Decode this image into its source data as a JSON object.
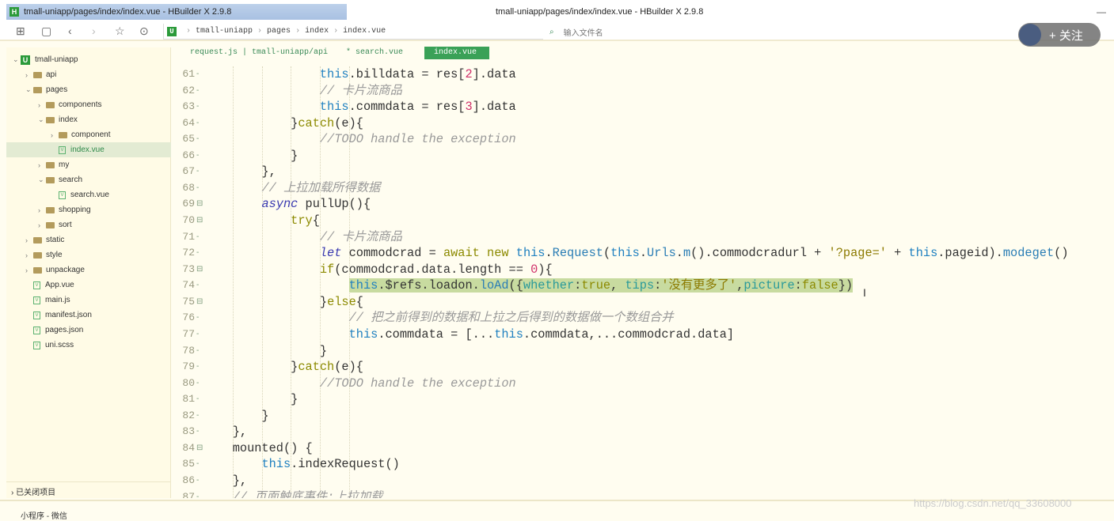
{
  "window": {
    "title": "tmall-uniapp/pages/index/index.vue - HBuilder X 2.9.8",
    "center_title": "tmall-uniapp/pages/index/index.vue - HBuilder X 2.9.8",
    "minimize": "—"
  },
  "toolbar": {
    "breadcrumb": [
      "tmall-uniapp",
      "pages",
      "index",
      "index.vue"
    ],
    "search_placeholder": "输入文件名"
  },
  "follow": {
    "label": "+ 关注"
  },
  "tabs": [
    {
      "label": "request.js | tmall-uniapp/api"
    },
    {
      "label": "* search.vue"
    },
    {
      "label": "index.vue",
      "active": true
    }
  ],
  "sidebar": {
    "items": [
      {
        "label": "tmall-uniapp",
        "type": "project",
        "level": 0,
        "open": true
      },
      {
        "label": "api",
        "type": "folder",
        "level": 1
      },
      {
        "label": "pages",
        "type": "folder",
        "level": 1,
        "open": true
      },
      {
        "label": "components",
        "type": "folder",
        "level": 2
      },
      {
        "label": "index",
        "type": "folder",
        "level": 2,
        "open": true
      },
      {
        "label": "component",
        "type": "folder",
        "level": 3
      },
      {
        "label": "index.vue",
        "type": "file",
        "level": 3,
        "selected": true
      },
      {
        "label": "my",
        "type": "folder",
        "level": 2
      },
      {
        "label": "search",
        "type": "folder",
        "level": 2,
        "open": true
      },
      {
        "label": "search.vue",
        "type": "file",
        "level": 3
      },
      {
        "label": "shopping",
        "type": "folder",
        "level": 2
      },
      {
        "label": "sort",
        "type": "folder",
        "level": 2
      },
      {
        "label": "static",
        "type": "folder",
        "level": 1
      },
      {
        "label": "style",
        "type": "folder",
        "level": 1
      },
      {
        "label": "unpackage",
        "type": "folder",
        "level": 1
      },
      {
        "label": "App.vue",
        "type": "file",
        "level": 1
      },
      {
        "label": "main.js",
        "type": "file",
        "level": 1
      },
      {
        "label": "manifest.json",
        "type": "file",
        "level": 1
      },
      {
        "label": "pages.json",
        "type": "file",
        "level": 1
      },
      {
        "label": "uni.scss",
        "type": "file",
        "level": 1
      }
    ],
    "closed_projects": "已关闭项目"
  },
  "editor": {
    "lines": [
      {
        "n": "61",
        "t": [
          [
            "",
            "                "
          ],
          [
            "kw",
            "this"
          ],
          [
            "",
            ".billdata = res["
          ],
          [
            "num",
            "2"
          ],
          [
            "",
            "].data"
          ]
        ]
      },
      {
        "n": "62",
        "t": [
          [
            "",
            "                "
          ],
          [
            "cm",
            "// 卡片流商品"
          ]
        ]
      },
      {
        "n": "63",
        "t": [
          [
            "",
            "                "
          ],
          [
            "kw",
            "this"
          ],
          [
            "",
            ".commdata = res["
          ],
          [
            "num",
            "3"
          ],
          [
            "",
            "].data"
          ]
        ]
      },
      {
        "n": "64",
        "t": [
          [
            "",
            "            }"
          ],
          [
            "ctl",
            "catch"
          ],
          [
            "",
            "(e){"
          ]
        ]
      },
      {
        "n": "65",
        "t": [
          [
            "",
            "                "
          ],
          [
            "cm",
            "//TODO handle the exception"
          ]
        ]
      },
      {
        "n": "66",
        "t": [
          [
            "",
            "            }"
          ]
        ]
      },
      {
        "n": "67",
        "t": [
          [
            "",
            "        },"
          ]
        ]
      },
      {
        "n": "68",
        "t": [
          [
            "",
            "        "
          ],
          [
            "cm",
            "// 上拉加载所得数据"
          ]
        ]
      },
      {
        "n": "69",
        "fold": true,
        "t": [
          [
            "",
            "        "
          ],
          [
            "dec",
            "async"
          ],
          [
            "",
            " pullUp(){"
          ]
        ]
      },
      {
        "n": "70",
        "fold": true,
        "t": [
          [
            "",
            "            "
          ],
          [
            "ctl",
            "try"
          ],
          [
            "",
            "{"
          ]
        ]
      },
      {
        "n": "71",
        "t": [
          [
            "",
            "                "
          ],
          [
            "cm",
            "// 卡片流商品"
          ]
        ]
      },
      {
        "n": "72",
        "t": [
          [
            "",
            "                "
          ],
          [
            "dec",
            "let"
          ],
          [
            "",
            " commodcrad = "
          ],
          [
            "ctl",
            "await"
          ],
          [
            "",
            " "
          ],
          [
            "ctl",
            "new"
          ],
          [
            "",
            " "
          ],
          [
            "kw",
            "this"
          ],
          [
            "",
            "."
          ],
          [
            "fn",
            "Request"
          ],
          [
            "",
            "("
          ],
          [
            "kw",
            "this"
          ],
          [
            "",
            "."
          ],
          [
            "fn",
            "Urls"
          ],
          [
            "",
            "."
          ],
          [
            "fn",
            "m"
          ],
          [
            "",
            "().commodcradurl + "
          ],
          [
            "str",
            "'?page='"
          ],
          [
            "",
            " + "
          ],
          [
            "kw",
            "this"
          ],
          [
            "",
            ".pageid)."
          ],
          [
            "fn",
            "modeget"
          ],
          [
            "",
            "()"
          ]
        ]
      },
      {
        "n": "73",
        "fold": true,
        "t": [
          [
            "",
            "                "
          ],
          [
            "ctl",
            "if"
          ],
          [
            "",
            "(commodcrad.data.length == "
          ],
          [
            "num",
            "0"
          ],
          [
            "",
            "){"
          ]
        ]
      },
      {
        "n": "74",
        "hl": true,
        "t": [
          [
            "",
            "                    "
          ],
          [
            "kw",
            "this"
          ],
          [
            "",
            ".$refs.loadon."
          ],
          [
            "fn",
            "loAd"
          ],
          [
            "",
            "({"
          ],
          [
            "prop",
            "whether"
          ],
          [
            "",
            ":"
          ],
          [
            "ctl",
            "true"
          ],
          [
            "",
            ", "
          ],
          [
            "prop",
            "tips"
          ],
          [
            "",
            ":"
          ],
          [
            "str",
            "'没有更多了'"
          ],
          [
            "",
            ","
          ],
          [
            "prop",
            "picture"
          ],
          [
            "",
            ":"
          ],
          [
            "ctl",
            "false"
          ],
          [
            "",
            "})"
          ]
        ]
      },
      {
        "n": "75",
        "fold": true,
        "t": [
          [
            "",
            "                }"
          ],
          [
            "ctl",
            "else"
          ],
          [
            "",
            "{"
          ]
        ]
      },
      {
        "n": "76",
        "t": [
          [
            "",
            "                    "
          ],
          [
            "cm",
            "// 把之前得到的数据和上拉之后得到的数据做一个数组合并"
          ]
        ]
      },
      {
        "n": "77",
        "t": [
          [
            "",
            "                    "
          ],
          [
            "kw",
            "this"
          ],
          [
            "",
            ".commdata = [..."
          ],
          [
            "kw",
            "this"
          ],
          [
            "",
            ".commdata,...commodcrad.data]"
          ]
        ]
      },
      {
        "n": "78",
        "t": [
          [
            "",
            "                }"
          ]
        ]
      },
      {
        "n": "79",
        "t": [
          [
            "",
            "            }"
          ],
          [
            "ctl",
            "catch"
          ],
          [
            "",
            "(e){"
          ]
        ]
      },
      {
        "n": "80",
        "t": [
          [
            "",
            "                "
          ],
          [
            "cm",
            "//TODO handle the exception"
          ]
        ]
      },
      {
        "n": "81",
        "t": [
          [
            "",
            "            }"
          ]
        ]
      },
      {
        "n": "82",
        "t": [
          [
            "",
            "        }"
          ]
        ]
      },
      {
        "n": "83",
        "t": [
          [
            "",
            "    },"
          ]
        ]
      },
      {
        "n": "84",
        "fold": true,
        "t": [
          [
            "",
            "    mounted() {"
          ]
        ]
      },
      {
        "n": "85",
        "t": [
          [
            "",
            "        "
          ],
          [
            "kw",
            "this"
          ],
          [
            "",
            ".indexRequest()"
          ]
        ]
      },
      {
        "n": "86",
        "t": [
          [
            "",
            "    },"
          ]
        ]
      },
      {
        "n": "87",
        "t": [
          [
            "",
            "    "
          ],
          [
            "cm",
            "// 页面触底事件:上拉加载"
          ]
        ]
      }
    ]
  },
  "statusbar": {
    "label": "小程序 - 微信"
  },
  "watermark": "https://blog.csdn.net/qq_33608000"
}
